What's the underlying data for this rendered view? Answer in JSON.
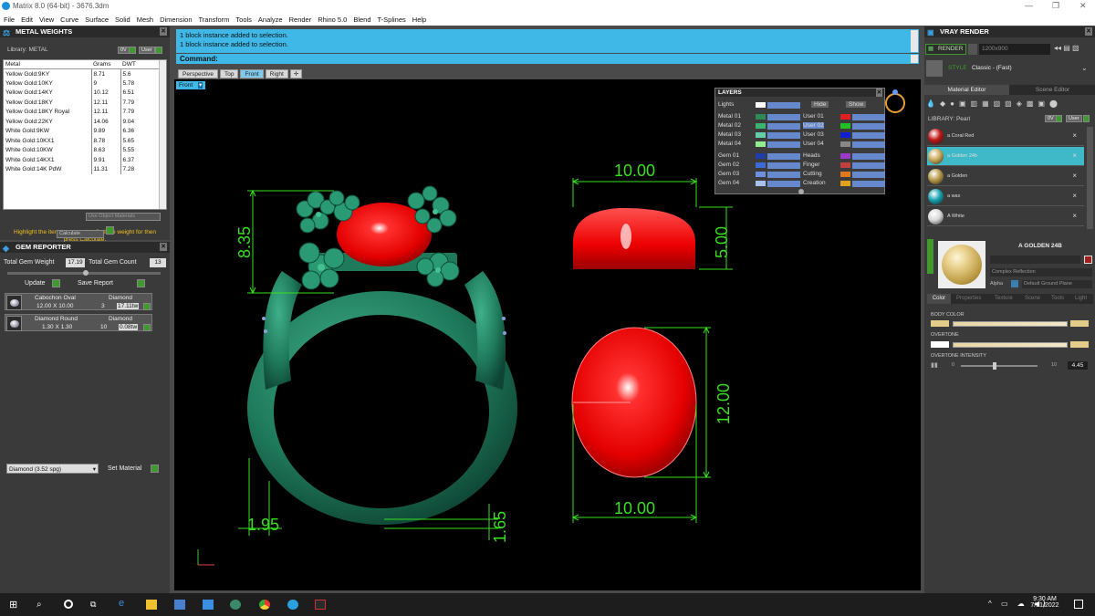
{
  "app": {
    "title": "Matrix 8.0 (64-bit) - 3676.3dm"
  },
  "menu": [
    "File",
    "Edit",
    "View",
    "Curve",
    "Surface",
    "Solid",
    "Mesh",
    "Dimension",
    "Transform",
    "Tools",
    "Analyze",
    "Render",
    "Rhino 5.0",
    "Blend",
    "T-Splines",
    "Help"
  ],
  "metal_weights": {
    "title": "METAL WEIGHTS",
    "library_label": "Library: METAL",
    "library_btn1": "0V",
    "library_btn2": "User",
    "columns": [
      "Metal",
      "Grams",
      "DWT"
    ],
    "rows": [
      [
        "Yellow Gold:9KY",
        "8.71",
        "5.6"
      ],
      [
        "Yellow Gold:10KY",
        "9",
        "5.78"
      ],
      [
        "Yellow Gold:14KY",
        "10.12",
        "6.51"
      ],
      [
        "Yellow Gold:18KY",
        "12.11",
        "7.79"
      ],
      [
        "Yellow Gold:18KY Royal",
        "12.11",
        "7.79"
      ],
      [
        "Yellow Gold:22KY",
        "14.06",
        "9.04"
      ],
      [
        "White Gold:9KW",
        "9.89",
        "6.36"
      ],
      [
        "White Gold:10KX1",
        "8.78",
        "5.65"
      ],
      [
        "White Gold:10KW",
        "8.63",
        "5.55"
      ],
      [
        "White Gold:14KX1",
        "9.91",
        "6.37"
      ],
      [
        "White Gold:14K PdW",
        "11.31",
        "7.28"
      ]
    ],
    "use_object_materials": "Use Object Materials",
    "hint": "Highlight the items you want to find the weight for then press Calculate.",
    "calculate": "Calculate"
  },
  "gem_reporter": {
    "title": "GEM REPORTER",
    "total_weight_label": "Total Gem Weight",
    "total_weight": "17.19",
    "total_count_label": "Total Gem Count",
    "total_count": "13",
    "update": "Update",
    "save_report": "Save Report",
    "gems": [
      {
        "shape": "Cabochon Oval",
        "size": "12.00 X 10.00",
        "material": "Diamond",
        "count": "3",
        "weight": "17.11tw"
      },
      {
        "shape": "Diamond Round",
        "size": "1.30 X 1.30",
        "material": "Diamond",
        "count": "10",
        "weight": "0.08tw"
      }
    ],
    "material_select": "Diamond     (3.52 spg)",
    "set_material": "Set Material"
  },
  "command": {
    "history": [
      "1 block instance added to selection.",
      "1 block instance added to selection."
    ],
    "label": "Command:"
  },
  "view_tabs": [
    "Perspective",
    "Top",
    "Front",
    "Right"
  ],
  "active_view_tab": "Front",
  "viewport_label": "Front",
  "dimensions": {
    "top_width": "10.00",
    "height_side": "5.00",
    "side_width": "12.00",
    "bottom_width": "10.00",
    "head_height": "8.35",
    "shank_width": "1.95",
    "shank_thick": "1.65"
  },
  "layers": {
    "title": "LAYERS",
    "lights": "Lights",
    "hide": "Hide",
    "show": "Show",
    "left": [
      {
        "name": "Metal 01",
        "color": "#2e8b57"
      },
      {
        "name": "Metal 02",
        "color": "#3cb371"
      },
      {
        "name": "Metal 03",
        "color": "#66cdaa"
      },
      {
        "name": "Metal 04",
        "color": "#90ee90"
      },
      {
        "name": "Gem 01",
        "color": "#1e3fa8"
      },
      {
        "name": "Gem 02",
        "color": "#3e6ad8"
      },
      {
        "name": "Gem 03",
        "color": "#6f8fe0"
      },
      {
        "name": "Gem 04",
        "color": "#a8c0f0"
      }
    ],
    "right": [
      {
        "name": "User 01",
        "color": "#e02020"
      },
      {
        "name": "User 02",
        "color": "#20c020"
      },
      {
        "name": "User 03",
        "color": "#1020d0"
      },
      {
        "name": "User 04",
        "color": "#888888"
      },
      {
        "name": "Heads",
        "color": "#9a3ac8"
      },
      {
        "name": "Finger",
        "color": "#c04040"
      },
      {
        "name": "Cutting",
        "color": "#e07820"
      },
      {
        "name": "Creation",
        "color": "#e0a020"
      }
    ]
  },
  "vray": {
    "title": "VRAY RENDER",
    "render_btn": "RENDER",
    "resolution": "1200x900",
    "style_label": "STYLE",
    "style_value": "Classic - (Fast)",
    "tabs": [
      "Material Editor",
      "Scene Editor"
    ],
    "library": "LIBRARY: Pearl",
    "lib_btn1": "0V",
    "lib_btn2": "User",
    "materials": [
      {
        "name": "a Coral Red",
        "color": "#c01818"
      },
      {
        "name": "a Golden 24b",
        "color": "#c8a858"
      },
      {
        "name": "a Golden",
        "color": "#b89848"
      },
      {
        "name": "a wax",
        "color": "#18a0b0"
      },
      {
        "name": "A White",
        "color": "#d8d8d8"
      }
    ],
    "selected_material": "A GOLDEN 24B",
    "reflection": "Complex Reflection",
    "alpha": "Alpha",
    "ground_plane": "Default Ground Plane",
    "prop_tabs": [
      "Color",
      "Properties",
      "Texture",
      "Scene",
      "Tools",
      "Light"
    ],
    "body_color": "BODY COLOR",
    "overtone": "OVERTONE",
    "overtone_intensity": "OVERTONE INTENSITY",
    "slider_min": "0",
    "slider_max": "10",
    "intensity": "4.45"
  },
  "taskbar": {
    "time": "9:30 AM",
    "date": "7/31/2022"
  }
}
